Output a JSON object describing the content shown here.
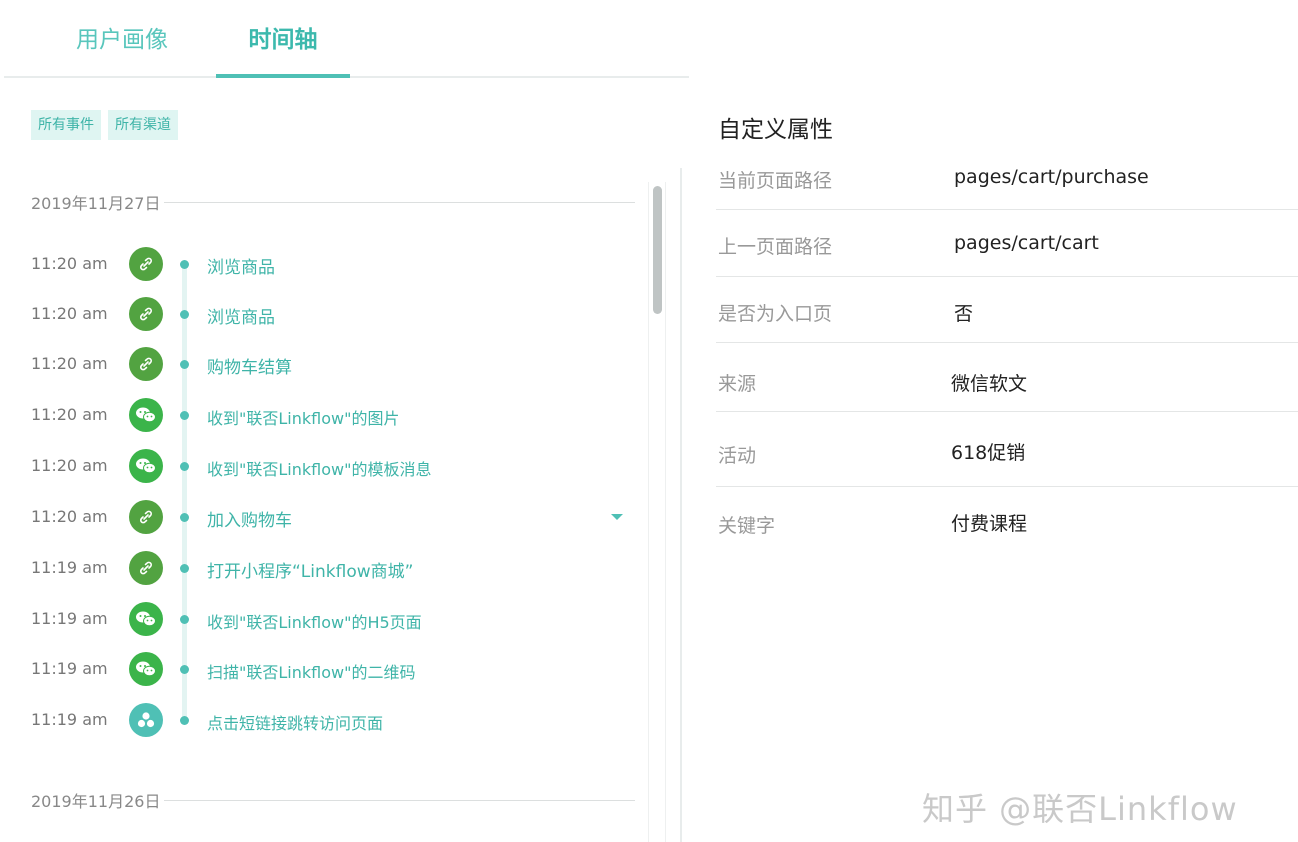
{
  "tabs": [
    {
      "label": "用户画像",
      "active": false
    },
    {
      "label": "时间轴",
      "active": true
    }
  ],
  "filters": [
    "所有事件",
    "所有渠道"
  ],
  "timeline": {
    "dates": [
      "2019年11月27日",
      "2019年11月26日"
    ],
    "events": [
      {
        "time": "11:20 am",
        "icon": "link-icon",
        "label": "浏览商品"
      },
      {
        "time": "11:20 am",
        "icon": "link-icon",
        "label": "浏览商品"
      },
      {
        "time": "11:20 am",
        "icon": "link-icon",
        "label": "购物车结算"
      },
      {
        "time": "11:20 am",
        "icon": "wechat-icon",
        "label": "收到\"联否Linkflow\"的图片"
      },
      {
        "time": "11:20 am",
        "icon": "wechat-icon",
        "label": "收到\"联否Linkflow\"的模板消息"
      },
      {
        "time": "11:20 am",
        "icon": "link-icon",
        "label": "加入购物车"
      },
      {
        "time": "11:19 am",
        "icon": "link-icon",
        "label": "打开小程序“Linkflow商城”"
      },
      {
        "time": "11:19 am",
        "icon": "wechat-icon",
        "label": "收到\"联否Linkflow\"的H5页面"
      },
      {
        "time": "11:19 am",
        "icon": "wechat-icon",
        "label": "扫描\"联否Linkflow\"的二维码"
      },
      {
        "time": "11:19 am",
        "icon": "share-icon",
        "label": "点击短链接跳转访问页面"
      }
    ]
  },
  "properties": {
    "title": "自定义属性",
    "rows": [
      {
        "key": "当前页面路径",
        "value": "pages/cart/purchase"
      },
      {
        "key": "上一页面路径",
        "value": "pages/cart/cart"
      },
      {
        "key": "是否为入口页",
        "value": "否"
      },
      {
        "key": "来源",
        "value": "微信软文"
      },
      {
        "key": "活动",
        "value": "618促销"
      },
      {
        "key": "关键字",
        "value": "付费课程"
      }
    ]
  },
  "watermark": "知乎 @联否Linkflow",
  "colors": {
    "accent": "#4fc0b5",
    "link_icon": "#52a341",
    "wechat_icon": "#3bb44a"
  }
}
